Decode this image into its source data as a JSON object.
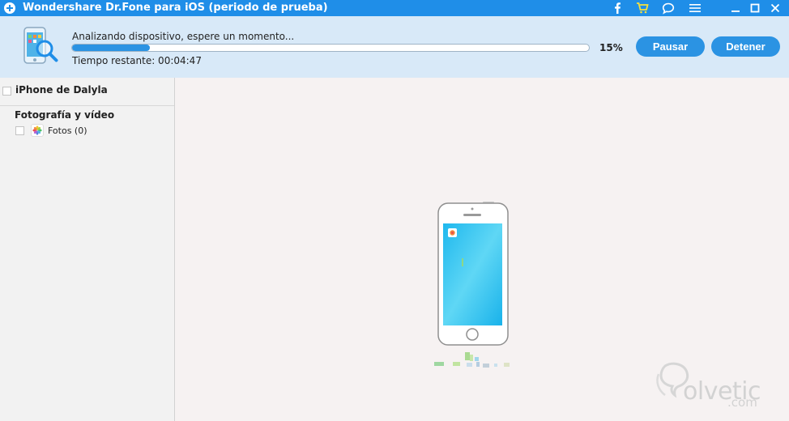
{
  "window": {
    "title": "Wondershare Dr.Fone para iOS (periodo de prueba)",
    "controls": [
      "facebook-icon",
      "cart-icon",
      "feedback-icon",
      "menu-icon",
      "minimize-icon",
      "maximize-icon",
      "close-icon"
    ]
  },
  "scan": {
    "status": "Analizando dispositivo, espere un momento...",
    "time_remaining": "Tiempo restante: 00:04:47",
    "progress": 0.15,
    "percent_label": "15%",
    "pause_label": "Pausar",
    "stop_label": "Detener"
  },
  "sidebar": {
    "device_name": "iPhone de Dalyla",
    "section": "Fotografía y vídeo",
    "items": [
      {
        "label": "Fotos (0)",
        "icon": "photos-icon"
      }
    ]
  },
  "watermark": {
    "brand": "olvetic",
    "suffix": ".com"
  },
  "colors": {
    "title_bar": "#1f8ee8",
    "accent": "#2b93e3",
    "header_bg": "#d8e9f8",
    "cart": "#f7e13b"
  }
}
